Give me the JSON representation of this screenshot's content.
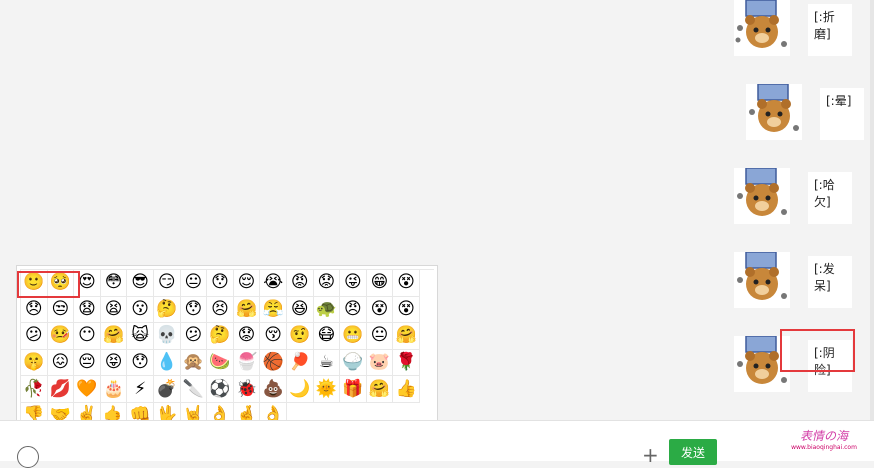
{
  "messages": [
    {
      "text": "[:折磨]"
    },
    {
      "text": "[:晕]"
    },
    {
      "text": "[:哈欠]"
    },
    {
      "text": "[:发呆]"
    },
    {
      "text": "[:阴险]"
    }
  ],
  "emoji_panel": {
    "emojis": [
      "🙂",
      "🥺",
      "😍",
      "😳",
      "😎",
      "😏",
      "😐",
      "😯",
      "😌",
      "😭",
      "😡",
      "😟",
      "😜",
      "😁",
      "😵",
      "😞",
      "😒",
      "😧",
      "😫",
      "😗",
      "🤔",
      "😯",
      "😣",
      "🤗",
      "😤",
      "😆",
      "🐢",
      "😠",
      "😵",
      "😵",
      "😕",
      "🤒",
      "😶",
      "🤗",
      "🙀",
      "💀",
      "😕",
      "🤔",
      "😟",
      "😚",
      "🤨",
      "😷",
      "😬",
      "😐",
      "🤗",
      "🤫",
      "😖",
      "😔",
      "😝",
      "😯",
      "💧",
      "🙊",
      "🍉",
      "🍧",
      "🏀",
      "🏓",
      "☕",
      "🍚",
      "🐷",
      "🌹",
      "🥀",
      "💋",
      "🧡",
      "🎂",
      "⚡",
      "💣",
      "🔪",
      "⚽",
      "🐞",
      "💩",
      "🌙",
      "🌞",
      "🎁",
      "🤗",
      "👍",
      "👎",
      "🤝",
      "✌️",
      "🤙",
      "👊",
      "🖖",
      "🤘",
      "👌",
      "🤞",
      "👌"
    ]
  },
  "composer": {
    "plus_label": "+",
    "send_label": "发送"
  },
  "watermark": {
    "title": "表情の海",
    "sub": "www.biaoqinghai.com"
  },
  "colors": {
    "send": "#2bab45",
    "highlight": "#e4393c",
    "background": "#f3f3f3"
  }
}
